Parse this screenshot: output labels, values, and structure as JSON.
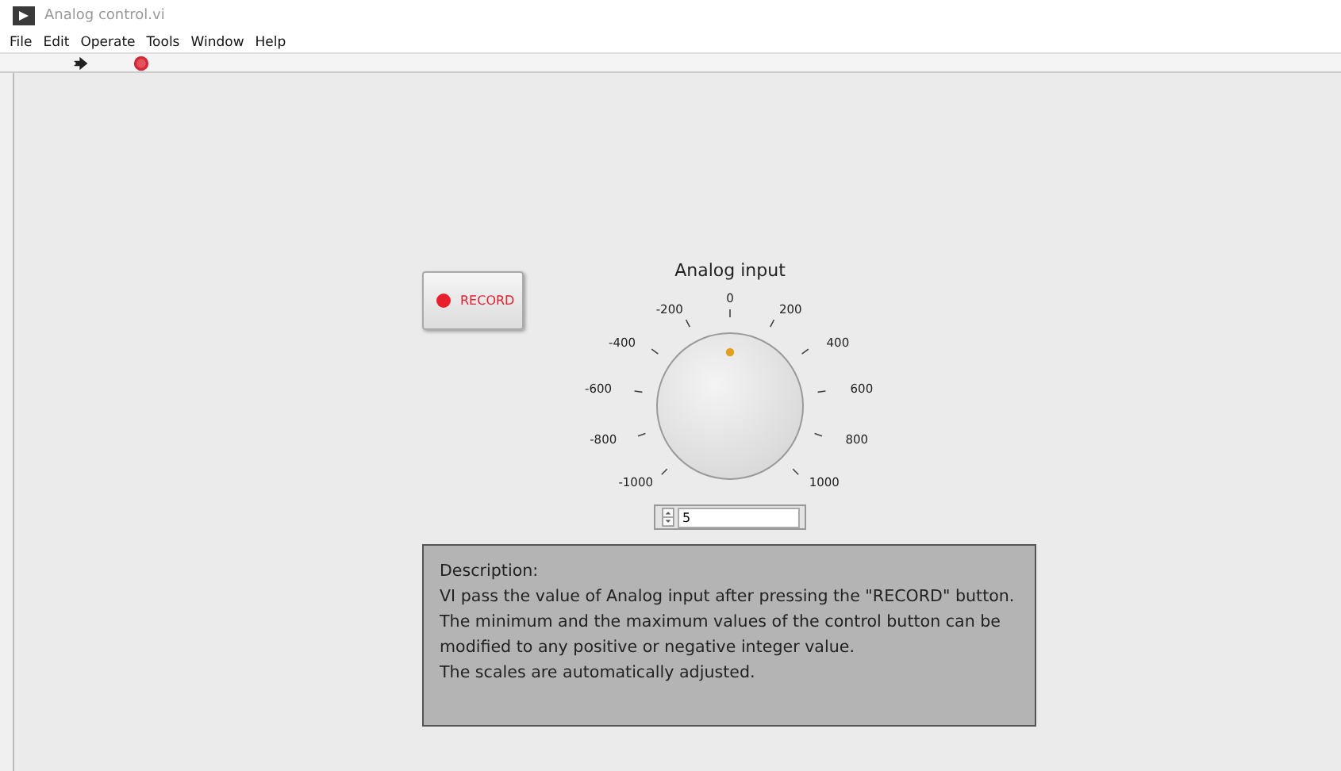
{
  "window": {
    "title": "Analog control.vi"
  },
  "menu": [
    "File",
    "Edit",
    "Operate",
    "Tools",
    "Window",
    "Help"
  ],
  "toolbar": [
    {
      "kind": "run"
    },
    {
      "kind": "abort"
    }
  ],
  "record_button": {
    "label": "RECORD",
    "on": true
  },
  "knob": {
    "label": "Analog input",
    "level": 0.5,
    "scale": [
      "-1000",
      "-800",
      "-600",
      "-400",
      "-200",
      "0",
      "200",
      "400",
      "600",
      "800",
      "1000"
    ],
    "value": "5"
  },
  "description": {
    "heading": "Description:",
    "lines": [
      "VI pass the value of Analog input after pressing the \"RECORD\" button.",
      "The minimum and the maximum values of the control button can be",
      "modified to any positive or negative integer value.",
      "The scales are automatically adjusted."
    ]
  }
}
